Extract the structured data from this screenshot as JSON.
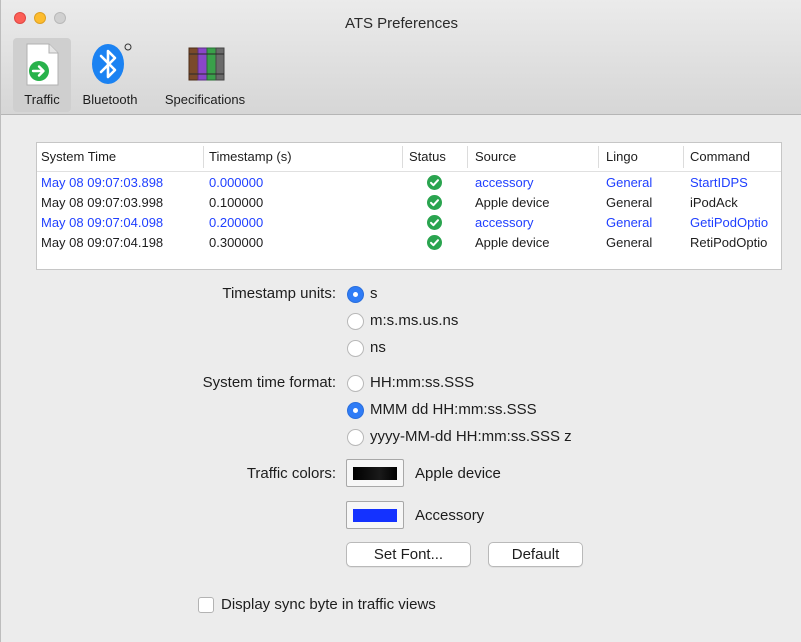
{
  "window": {
    "title": "ATS Preferences"
  },
  "toolbar": {
    "items": [
      {
        "label": "Traffic",
        "icon": "traffic-document-icon",
        "selected": true
      },
      {
        "label": "Bluetooth",
        "icon": "bluetooth-icon",
        "selected": false
      },
      {
        "label": "Specifications",
        "icon": "specifications-books-icon",
        "selected": false
      }
    ]
  },
  "log_table": {
    "columns": [
      "System Time",
      "Timestamp (s)",
      "Status",
      "Source",
      "Lingo",
      "Command"
    ],
    "rows": [
      {
        "system_time": "May 08 09:07:03.898",
        "timestamp": "0.000000",
        "status": "check-icon",
        "source": "accessory",
        "lingo": "General",
        "command": "StartIDPS",
        "kind": "accessory"
      },
      {
        "system_time": "May 08 09:07:03.998",
        "timestamp": "0.100000",
        "status": "check-icon",
        "source": "Apple device",
        "lingo": "General",
        "command": "iPodAck",
        "kind": "apple"
      },
      {
        "system_time": "May 08 09:07:04.098",
        "timestamp": "0.200000",
        "status": "check-icon",
        "source": "accessory",
        "lingo": "General",
        "command": "GetiPodOptio",
        "kind": "accessory"
      },
      {
        "system_time": "May 08 09:07:04.198",
        "timestamp": "0.300000",
        "status": "check-icon",
        "source": "Apple device",
        "lingo": "General",
        "command": "RetiPodOptio",
        "kind": "apple"
      }
    ]
  },
  "settings": {
    "timestamp_units": {
      "label": "Timestamp units:",
      "options": [
        "s",
        "m:s.ms.us.ns",
        "ns"
      ],
      "selected": "s"
    },
    "system_time_format": {
      "label": "System time format:",
      "options": [
        "HH:mm:ss.SSS",
        "MMM dd HH:mm:ss.SSS",
        "yyyy-MM-dd HH:mm:ss.SSS z"
      ],
      "selected": "MMM dd HH:mm:ss.SSS"
    },
    "traffic_colors": {
      "label": "Traffic colors:",
      "items": [
        {
          "name": "Apple device",
          "color": "#000000"
        },
        {
          "name": "Accessory",
          "color": "#1432ff"
        }
      ]
    },
    "buttons": {
      "set_font": "Set Font...",
      "default": "Default"
    },
    "display_sync_byte": {
      "label": "Display sync byte in traffic views",
      "checked": false
    }
  },
  "colors": {
    "accessory_text": "#1f3fff",
    "radio_selected": "#2f7cf6",
    "status_check": "#2aa44f"
  }
}
